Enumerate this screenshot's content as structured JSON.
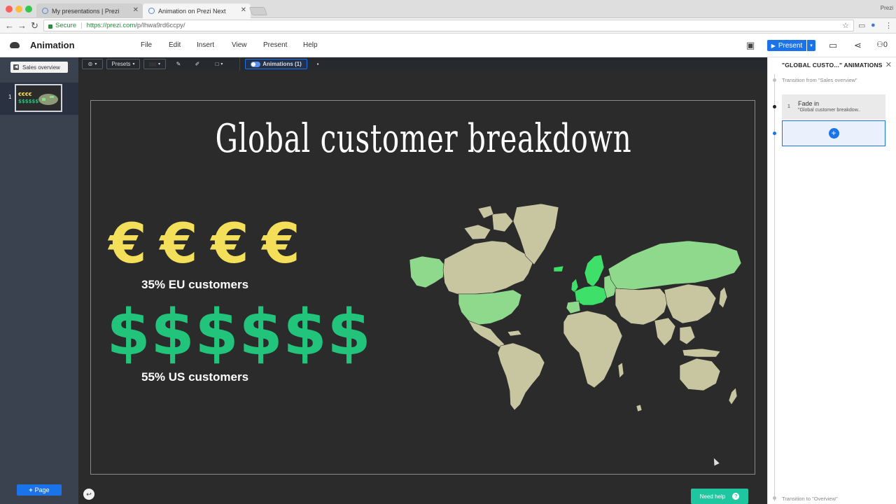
{
  "browser": {
    "tabs": [
      {
        "title": "My presentations | Prezi",
        "active": false
      },
      {
        "title": "Animation on Prezi Next",
        "active": true
      }
    ],
    "user_label": "Prezi",
    "secure_label": "Secure",
    "url_host": "https://prezi.com",
    "url_path": "/p/lhwa9rd6ccpy/"
  },
  "app": {
    "title": "Animation",
    "menu": [
      "File",
      "Edit",
      "Insert",
      "View",
      "Present",
      "Help"
    ],
    "present_label": "Present",
    "collaborator_count": "0"
  },
  "left_panel": {
    "overview_label": "Sales overview",
    "slides": [
      {
        "number": "1"
      }
    ],
    "add_page_label": "Page"
  },
  "toolbar": {
    "presets_label": "Presets",
    "animations_label": "Animations (1)"
  },
  "slide": {
    "title": "Global customer breakdown",
    "euro_symbols": [
      "€",
      "€",
      "€",
      "€"
    ],
    "eu_stat": "35% EU customers",
    "dollar_symbols": [
      "$",
      "$",
      "$",
      "$",
      "$",
      "$"
    ],
    "us_stat": "55% US customers"
  },
  "help": {
    "label": "Need help"
  },
  "animations_panel": {
    "title": "\"GLOBAL CUSTO...\" ANIMATIONS",
    "transition_from": "Transition from \"Sales overview\"",
    "items": [
      {
        "number": "1",
        "effect": "Fade in",
        "target": "\"Global customer breakdow.."
      }
    ],
    "transition_to": "Transition to \"Overview\""
  },
  "colors": {
    "accent": "#1a73e8",
    "euro": "#f4df5a",
    "dollar": "#22c47c",
    "map_land": "#c8c6a0",
    "map_highlight": "#8ed98c",
    "map_bright": "#3ee06a",
    "help": "#1fc7a0"
  }
}
